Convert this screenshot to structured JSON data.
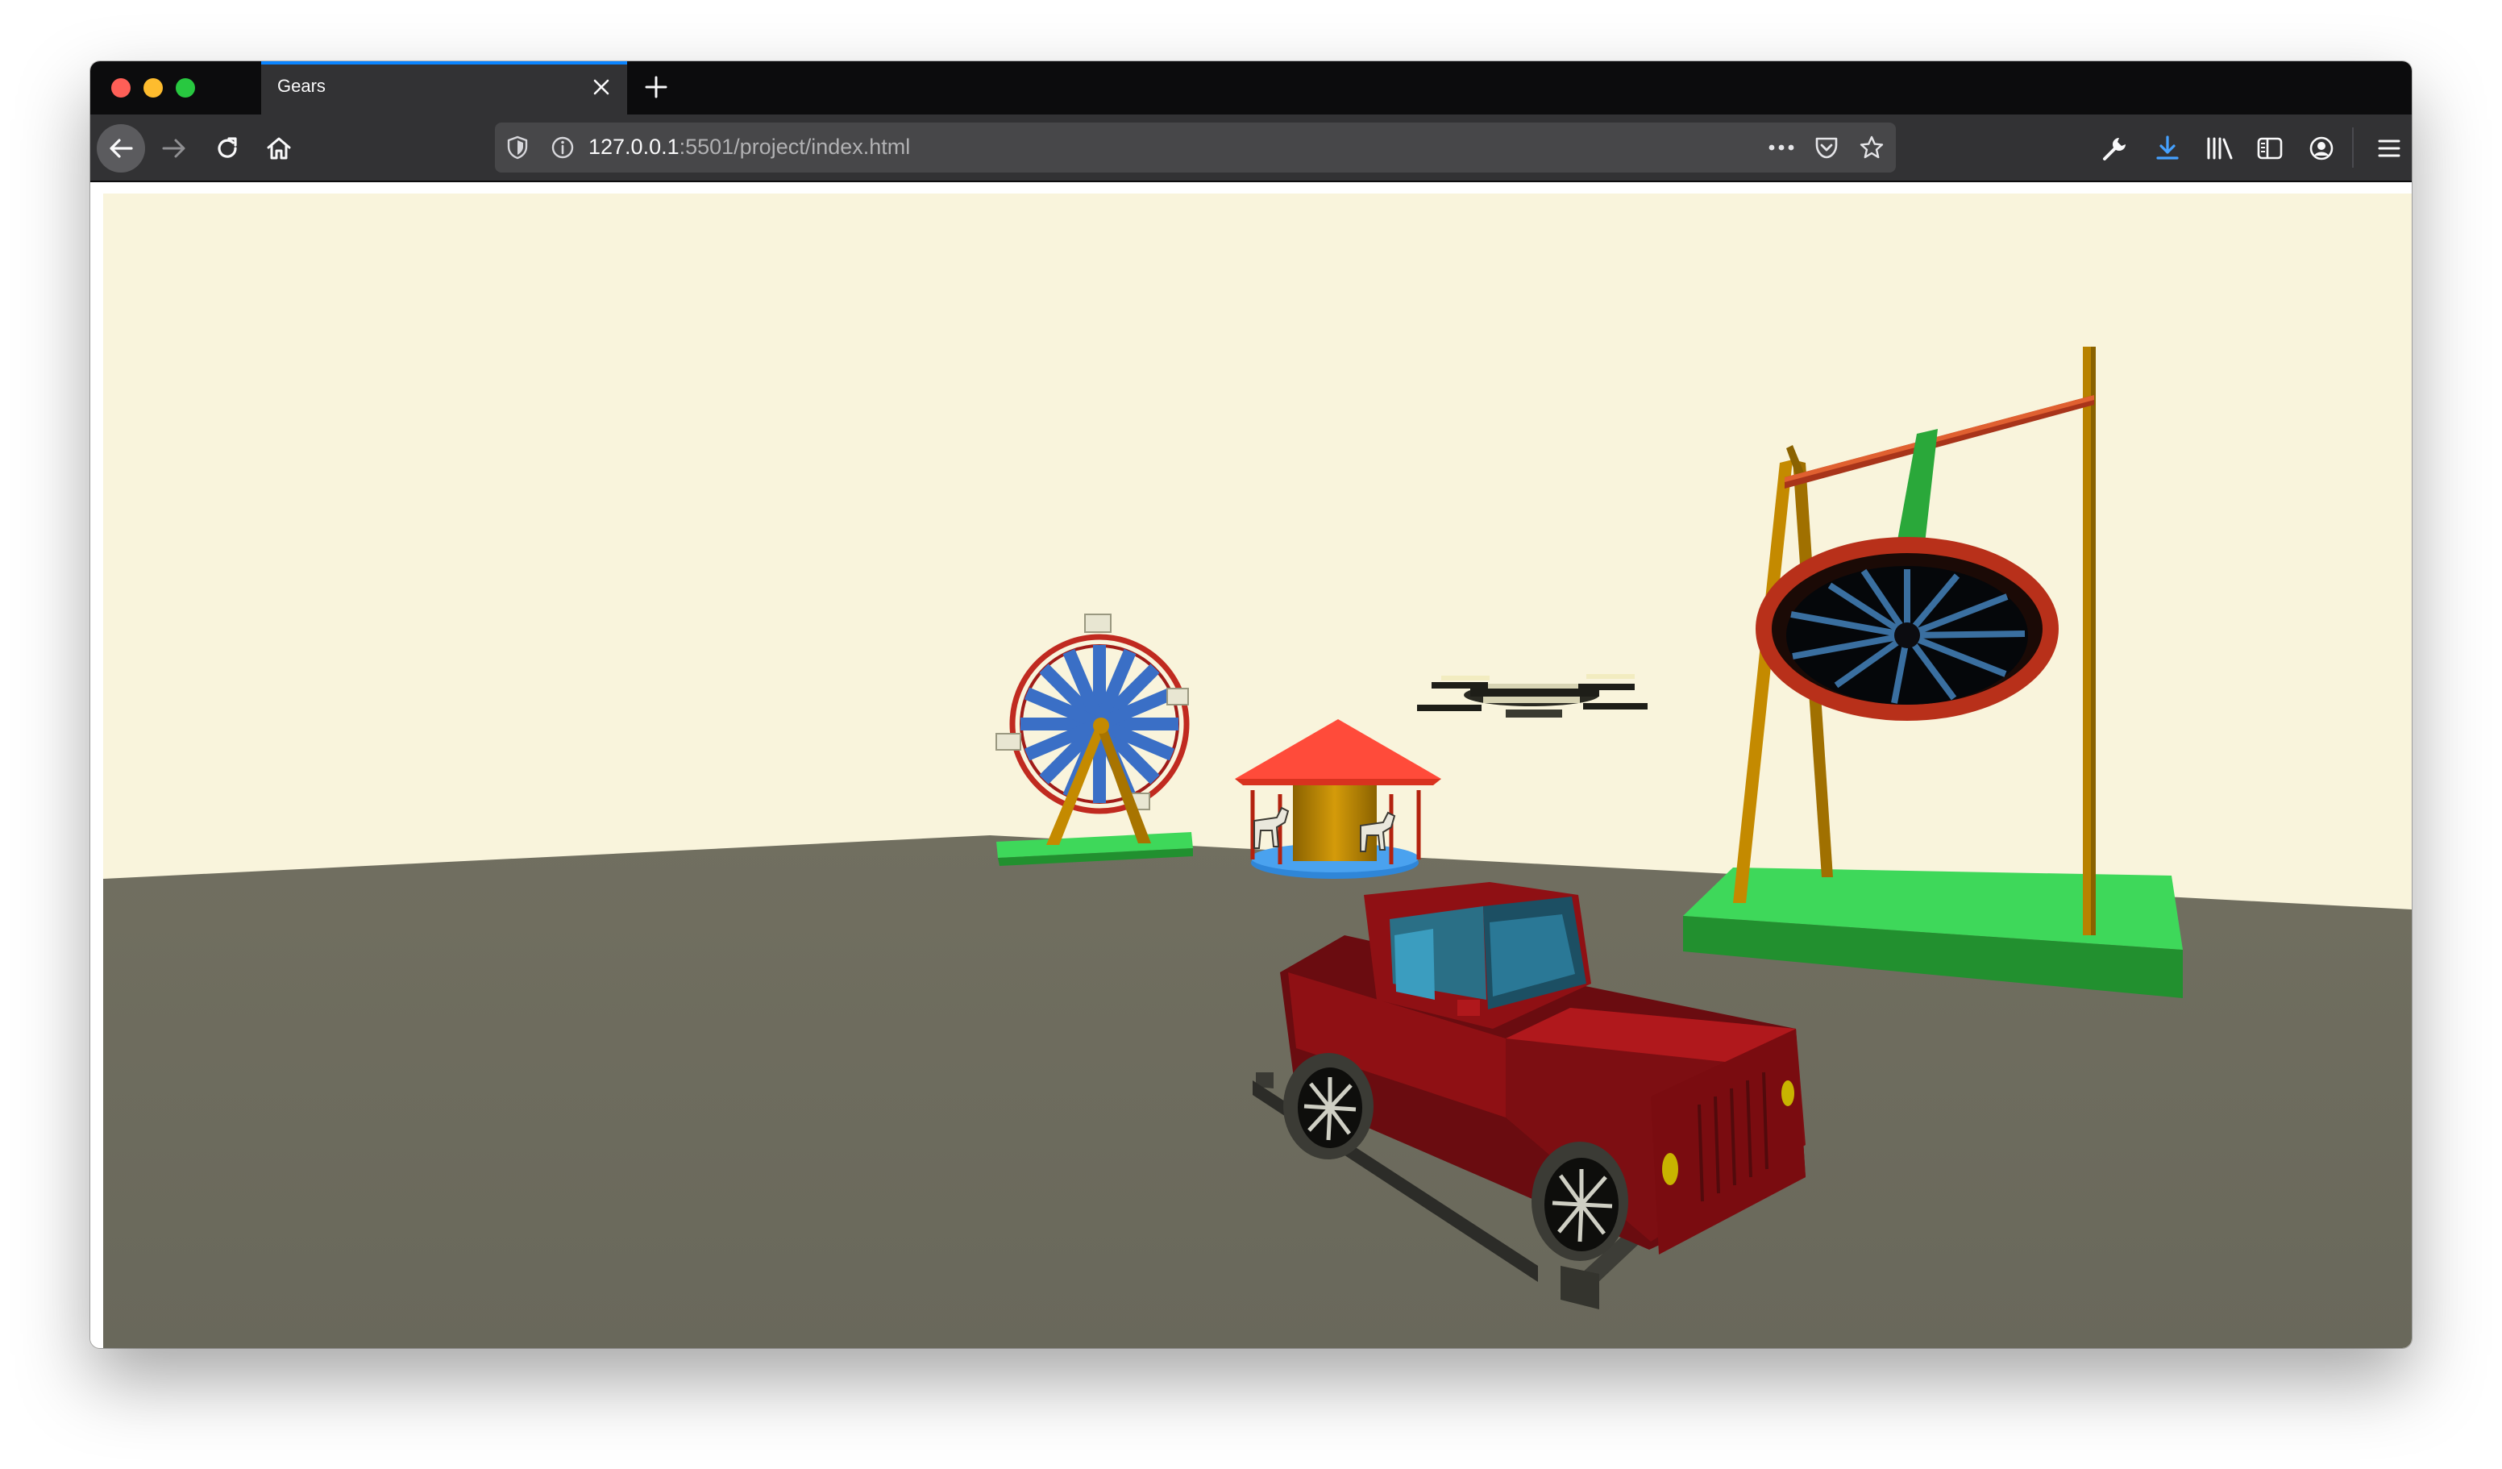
{
  "browser": {
    "tab": {
      "title": "Gears"
    },
    "url": {
      "host": "127.0.0.1",
      "rest": ":5501/project/index.html"
    }
  },
  "colors": {
    "sky": "#f9f4dc",
    "ground": "#6e6d5e",
    "car_body": "#8f1014",
    "platform_green": "#3ed85a",
    "wheel_blue": "#3a6fc6",
    "carousel_roof": "#ff4b3a",
    "frame_gold": "#c48a00",
    "accent_blue": "#0a84ff"
  },
  "icons": {
    "close": "close-icon",
    "new_tab": "plus-icon",
    "back": "arrow-left-icon",
    "forward": "arrow-right-icon",
    "reload": "reload-icon",
    "home": "home-icon",
    "shield": "shield-icon",
    "info": "info-icon",
    "more": "more-icon",
    "pocket": "pocket-icon",
    "star": "star-icon",
    "wrench": "wrench-icon",
    "download": "download-icon",
    "library": "library-icon",
    "sidebar": "sidebar-icon",
    "account": "account-icon",
    "menu": "hamburger-icon"
  }
}
